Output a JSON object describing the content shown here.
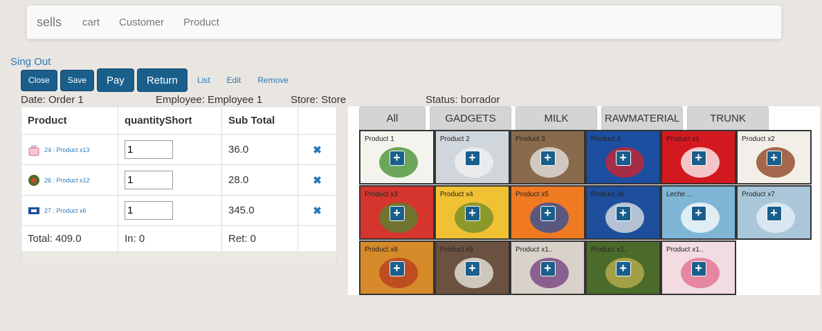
{
  "navbar": {
    "brand": "sells",
    "links": [
      "cart",
      "Customer",
      "Product"
    ]
  },
  "signout": "Sing Out",
  "toolbar": {
    "close": "Close",
    "save": "Save",
    "pay": "Pay",
    "return": "Return",
    "list": "List",
    "edit": "Edit",
    "remove": "Remove"
  },
  "info": {
    "date": "Date: Order 1",
    "employee": "Employee: Employee 1",
    "store": "Store: Store",
    "status": "Status: borrador"
  },
  "order_table": {
    "headers": [
      "Product",
      "quantityShort",
      "Sub Total",
      ""
    ],
    "rows": [
      {
        "product": "24 : Product x13",
        "qty": "1",
        "subtotal": "36.0",
        "delete_icon": "✖"
      },
      {
        "product": "26 : Product x12",
        "qty": "1",
        "subtotal": "28.0",
        "delete_icon": "✖"
      },
      {
        "product": "27 : Product x6",
        "qty": "1",
        "subtotal": "345.0",
        "delete_icon": "✖"
      }
    ],
    "total": "Total: 409.0",
    "in": "In: 0",
    "ret": "Ret: 0"
  },
  "categories": [
    "All",
    "GADGETS",
    "MILK",
    "RAWMATERIAL",
    "TRUNK"
  ],
  "products": [
    {
      "name": "Product 1",
      "bg": "#f4f4ee",
      "accent": "#3f8c2a"
    },
    {
      "name": "Product 2",
      "bg": "#cfd6dc",
      "accent": "#f2f2f2"
    },
    {
      "name": "Product 3",
      "bg": "#8a6a4c",
      "accent": "#e8e8e8"
    },
    {
      "name": "Product 4",
      "bg": "#1c4fa0",
      "accent": "#d62027"
    },
    {
      "name": "Product x1",
      "bg": "#d31820",
      "accent": "#ffffff"
    },
    {
      "name": "Product x2",
      "bg": "#f2efe8",
      "accent": "#8a3a1a"
    },
    {
      "name": "Product x3",
      "bg": "#d5352c",
      "accent": "#4f8a2f"
    },
    {
      "name": "Product x4",
      "bg": "#f0c132",
      "accent": "#6c8a2a"
    },
    {
      "name": "Product x5",
      "bg": "#f07a22",
      "accent": "#2a4ea0"
    },
    {
      "name": "Product x6",
      "bg": "#1d4f9c",
      "accent": "#e8e8e8"
    },
    {
      "name": "Leche ...",
      "bg": "#7fb6d6",
      "accent": "#ffffff"
    },
    {
      "name": "Product x7",
      "bg": "#a9c7d9",
      "accent": "#e8f2f7"
    },
    {
      "name": "Product x8",
      "bg": "#d68a2a",
      "accent": "#b53a1f"
    },
    {
      "name": "Product x9",
      "bg": "#6a5140",
      "accent": "#efefe6"
    },
    {
      "name": "Product x1..",
      "bg": "#d9d2cb",
      "accent": "#6d3a7a"
    },
    {
      "name": "Product x1..",
      "bg": "#4b6b2a",
      "accent": "#c0b050"
    },
    {
      "name": "Product x1..",
      "bg": "#f3dbe2",
      "accent": "#e06a8c"
    }
  ],
  "plus_icon": "+"
}
